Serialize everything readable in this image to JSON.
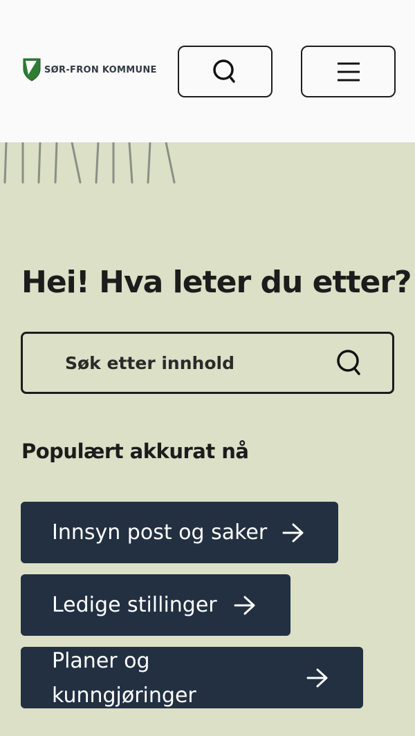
{
  "header": {
    "logo_text": "SØR-FRON KOMMUNE",
    "search_button_icon": "search-icon",
    "menu_button_icon": "hamburger-menu-icon"
  },
  "hero": {
    "title": "Hei! Hva leter du etter?"
  },
  "search": {
    "placeholder": "Søk etter innhold",
    "icon": "search-icon"
  },
  "popular": {
    "heading": "Populært akkurat nå",
    "links": [
      {
        "label": "Innsyn post og saker",
        "icon": "arrow-right-icon"
      },
      {
        "label": "Ledige stillinger",
        "icon": "arrow-right-icon"
      },
      {
        "label": "Planer og kunngjøringer",
        "icon": "arrow-right-icon"
      }
    ]
  },
  "colors": {
    "header_bg": "#fafafa",
    "page_bg": "#dbe0c6",
    "button_dark": "#223042",
    "logo_green": "#2e7d32"
  }
}
